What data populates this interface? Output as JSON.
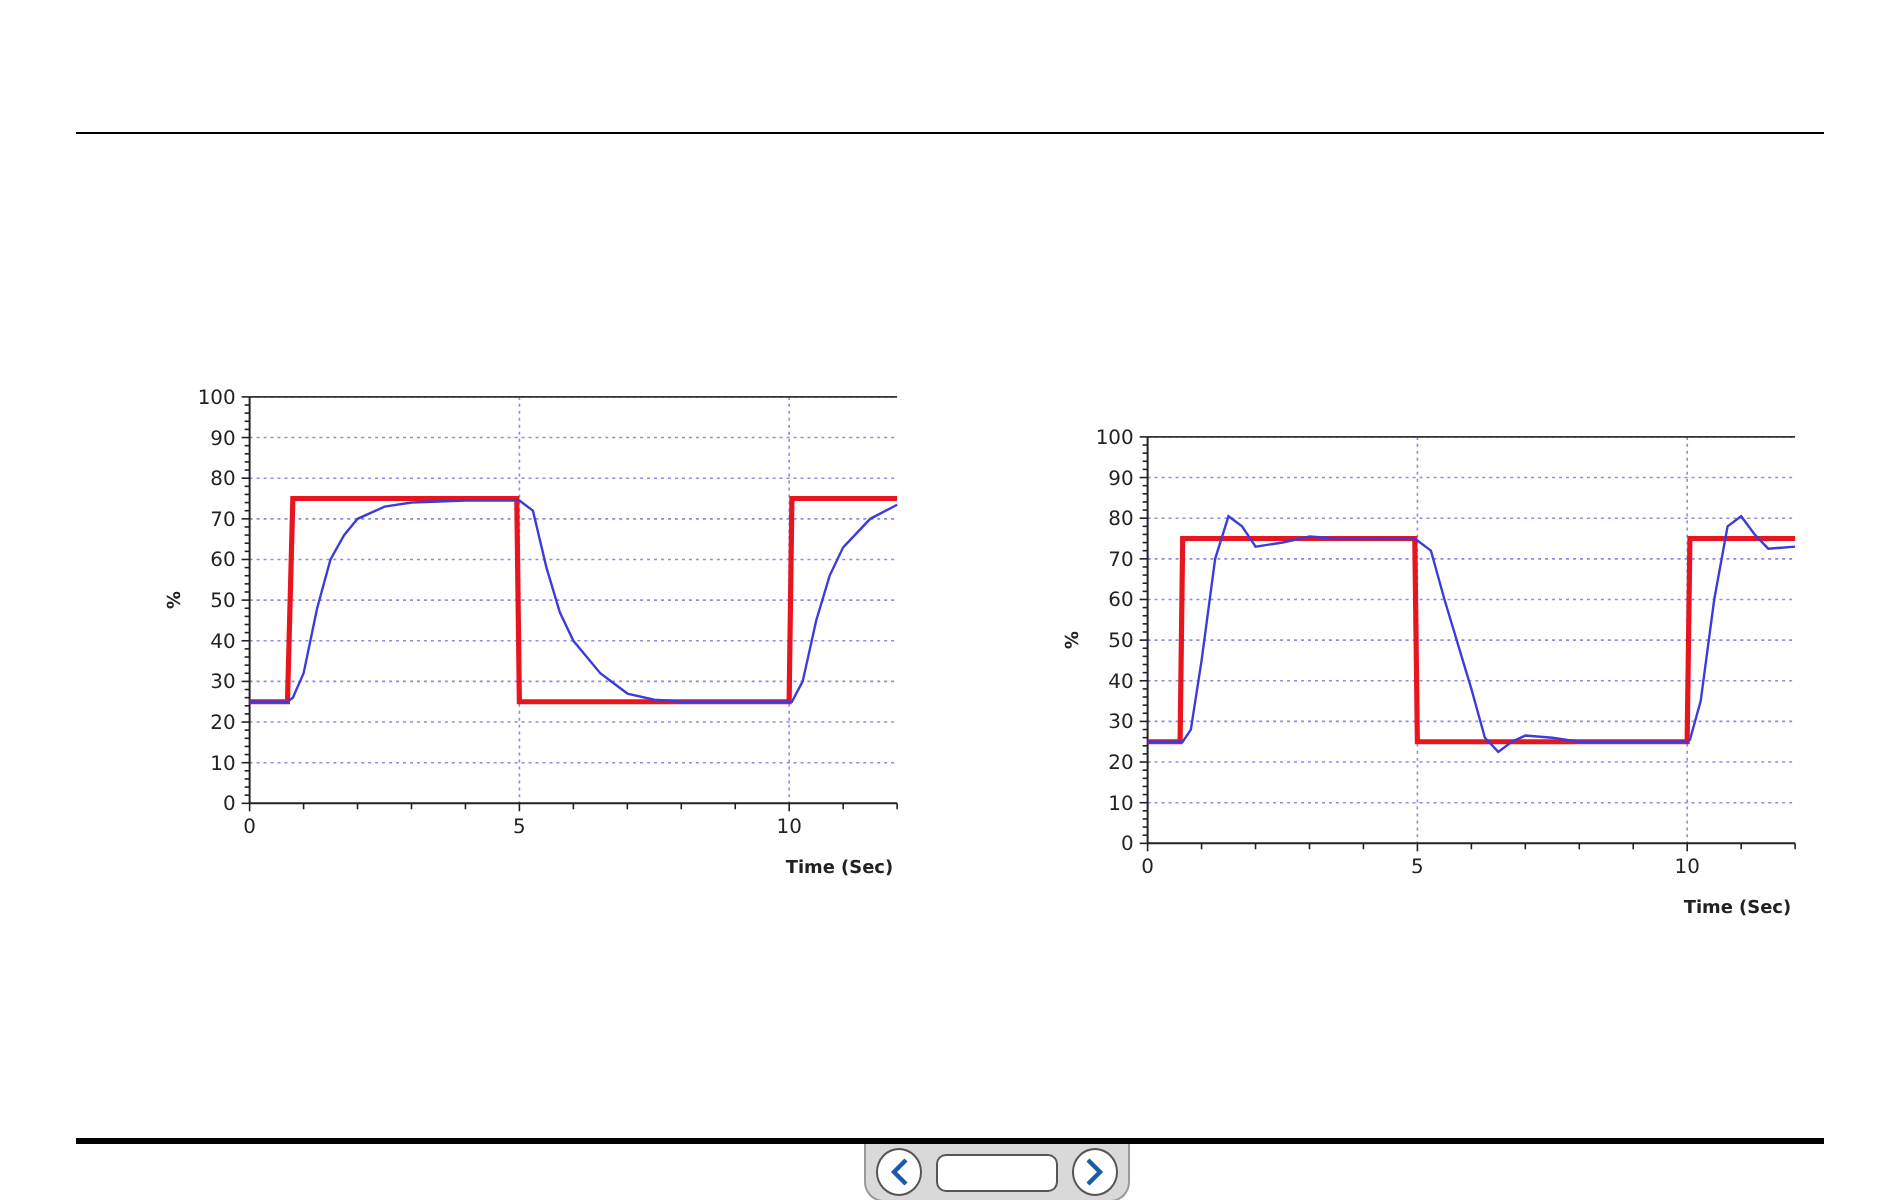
{
  "charts": [
    {
      "chart_data": {
        "type": "line",
        "grid": true,
        "xlabel": "Time (Sec)",
        "ylabel": "%",
        "x": [
          0,
          0.7,
          0.8,
          1.0,
          1.25,
          1.5,
          1.75,
          2,
          2.5,
          3,
          4,
          4.95,
          5.0,
          5.25,
          5.5,
          5.75,
          6,
          6.5,
          7,
          7.5,
          8,
          9,
          10.0,
          10.05,
          10.25,
          10.5,
          10.75,
          11,
          11.5,
          12
        ],
        "xlim": [
          0,
          12
        ],
        "ylim": [
          0,
          100
        ],
        "xticks": [
          0,
          5,
          10
        ],
        "yticks": [
          0,
          10,
          20,
          30,
          40,
          50,
          60,
          70,
          80,
          90,
          100
        ],
        "series": [
          {
            "color": "#e8141e",
            "values": [
              25,
              25,
              75,
              75,
              75,
              75,
              75,
              75,
              75,
              75,
              75,
              75,
              25,
              25,
              25,
              25,
              25,
              25,
              25,
              25,
              25,
              25,
              25,
              75,
              75,
              75,
              75,
              75,
              75,
              75
            ]
          },
          {
            "color": "#3c3cdc",
            "values": [
              25,
              25,
              26,
              32,
              48,
              60,
              66,
              70,
              73,
              74,
              74.5,
              74.5,
              74.5,
              72,
              58,
              47,
              40,
              32,
              27,
              25.5,
              25,
              25,
              25,
              25,
              30,
              45,
              56,
              63,
              70,
              73.5
            ]
          }
        ]
      }
    },
    {
      "chart_data": {
        "type": "line",
        "grid": true,
        "xlabel": "Time (Sec)",
        "ylabel": "%",
        "x": [
          0,
          0.6,
          0.65,
          0.8,
          1.0,
          1.25,
          1.5,
          1.75,
          2,
          2.5,
          3,
          3.5,
          4.95,
          5.0,
          5.25,
          5.5,
          6,
          6.25,
          6.5,
          6.75,
          7,
          7.5,
          8,
          9,
          10.0,
          10.05,
          10.25,
          10.5,
          10.75,
          11,
          11.25,
          11.5,
          12
        ],
        "xlim": [
          0,
          12
        ],
        "ylim": [
          0,
          100
        ],
        "xticks": [
          0,
          5,
          10
        ],
        "yticks": [
          0,
          10,
          20,
          30,
          40,
          50,
          60,
          70,
          80,
          90,
          100
        ],
        "series": [
          {
            "color": "#e8141e",
            "values": [
              25,
              25,
              75,
              75,
              75,
              75,
              75,
              75,
              75,
              75,
              75,
              75,
              75,
              25,
              25,
              25,
              25,
              25,
              25,
              25,
              25,
              25,
              25,
              25,
              25,
              75,
              75,
              75,
              75,
              75,
              75,
              75,
              75
            ]
          },
          {
            "color": "#3c3cdc",
            "values": [
              25,
              25,
              25,
              28,
              45,
              70,
              80.5,
              78,
              73,
              74,
              75.5,
              75,
              75,
              74.5,
              72,
              60,
              38,
              26,
              22.5,
              25,
              26.5,
              26,
              25,
              25,
              25,
              25.5,
              35,
              60,
              78,
              80.5,
              76,
              72.5,
              73
            ]
          }
        ]
      }
    }
  ]
}
